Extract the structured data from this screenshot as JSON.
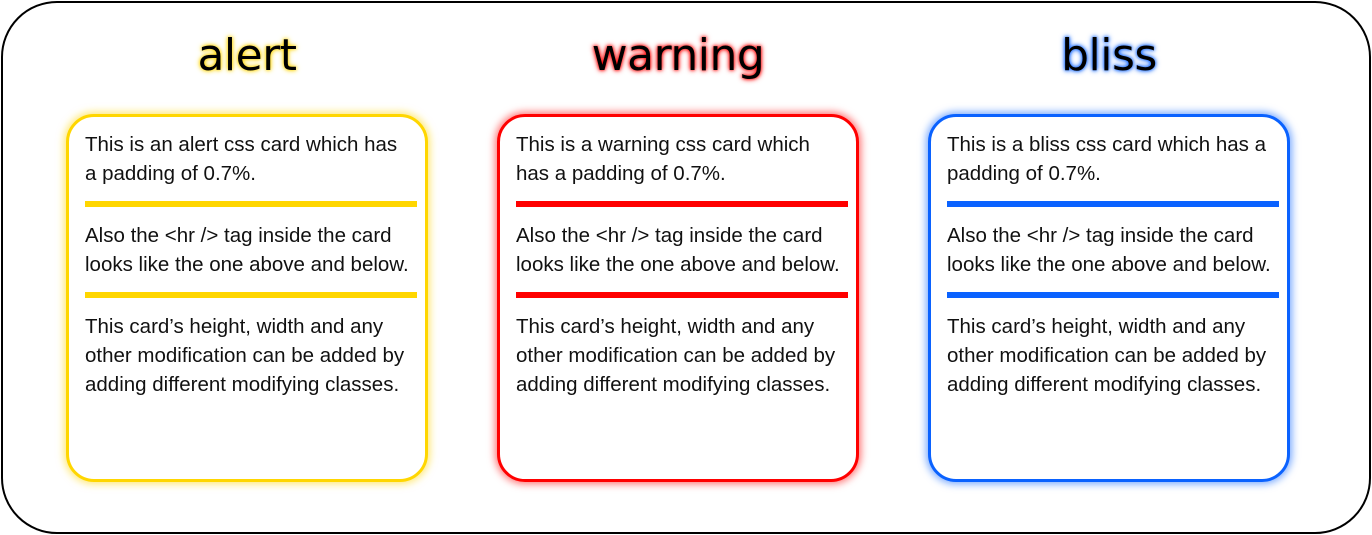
{
  "colors": {
    "alert": "#ffd600",
    "warning": "#ff0000",
    "bliss": "#0a62ff"
  },
  "cards": [
    {
      "title": "alert",
      "para1": "This is an alert css card which has a padding of 0.7%.",
      "para2": "Also the <hr /> tag inside the card looks like the one above and below.",
      "para3": "This card’s height, width and any other modification can be added by adding different modifying classes."
    },
    {
      "title": "warning",
      "para1": "This is a warning css card which has a padding of 0.7%.",
      "para2": "Also the <hr /> tag inside the card looks like the one above and below.",
      "para3": "This card’s height, width and any other modification can be added by adding different modifying classes."
    },
    {
      "title": "bliss",
      "para1": "This is a bliss css card which has a padding of 0.7%.",
      "para2": "Also the <hr /> tag inside the card looks like the one above and below.",
      "para3": "This card’s height, width and any other modification can be added by adding different modifying classes."
    }
  ]
}
